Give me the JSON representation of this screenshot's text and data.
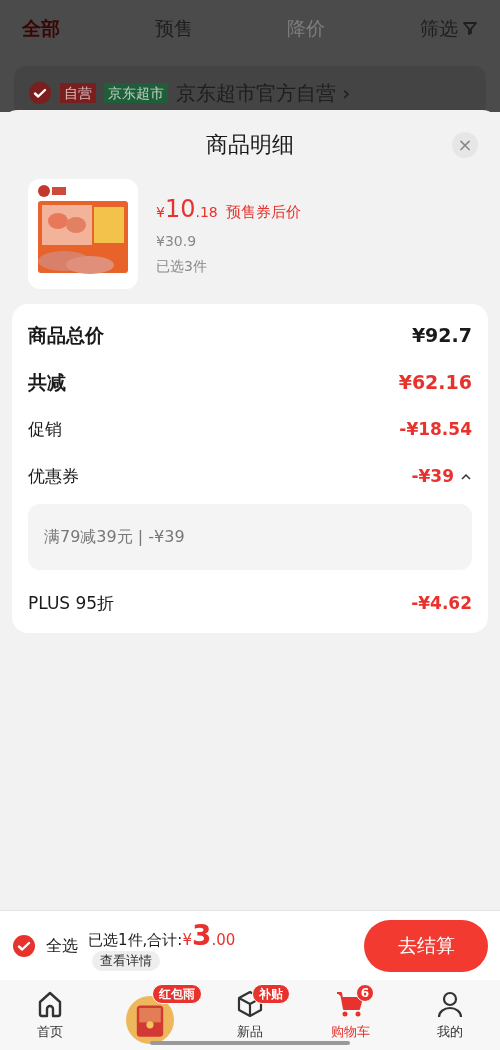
{
  "top_tabs": [
    {
      "label": "全部",
      "selected": true,
      "disabled": false
    },
    {
      "label": "预售",
      "selected": false,
      "disabled": false
    },
    {
      "label": "降价",
      "selected": false,
      "disabled": true
    }
  ],
  "filter": {
    "label": "筛选"
  },
  "store": {
    "checked": true,
    "badges": [
      {
        "text": "自营",
        "color": "#7a1e1e"
      },
      {
        "text": "京东超市",
        "color": "#1f5e38"
      }
    ],
    "name": "京东超市官方自营",
    "arrow": "›"
  },
  "sheet": {
    "title": "商品明细",
    "close": "×",
    "product": {
      "kind": "picture",
      "currency": "¥",
      "price_int": "10",
      "price_dec": ".18",
      "price_note": "预售券后价",
      "original_price": "¥30.9",
      "quantity": "已选3件"
    },
    "rows": [
      {
        "kind": "total",
        "label": "商品总价",
        "value": "¥92.7"
      },
      {
        "kind": "saving",
        "label": "共减",
        "value": "¥62.16"
      },
      {
        "kind": "item",
        "label": "促销",
        "value": "-¥18.54"
      },
      {
        "kind": "expandable",
        "label": "优惠券",
        "value": "-¥39",
        "expanded": true,
        "detail": "满79减39元 | -¥39"
      },
      {
        "kind": "item",
        "label": "PLUS 95折",
        "value": "-¥4.62"
      }
    ]
  },
  "bottom_bar": {
    "select_all": {
      "label": "全选",
      "checked": true
    },
    "summary": "已选1件,合计:",
    "currency": "¥",
    "total_int": "3",
    "total_dec": ".00",
    "details": "查看详情",
    "checkout": "去结算"
  },
  "nav": [
    {
      "kind": "home",
      "label": "首页",
      "selected": false
    },
    {
      "kind": "promo",
      "badge": "红包雨",
      "selected": false
    },
    {
      "kind": "new",
      "label": "新品",
      "badge": "补贴",
      "selected": false
    },
    {
      "kind": "cart",
      "label": "购物车",
      "badge": "6",
      "selected": true
    },
    {
      "kind": "me",
      "label": "我的",
      "selected": false
    }
  ]
}
